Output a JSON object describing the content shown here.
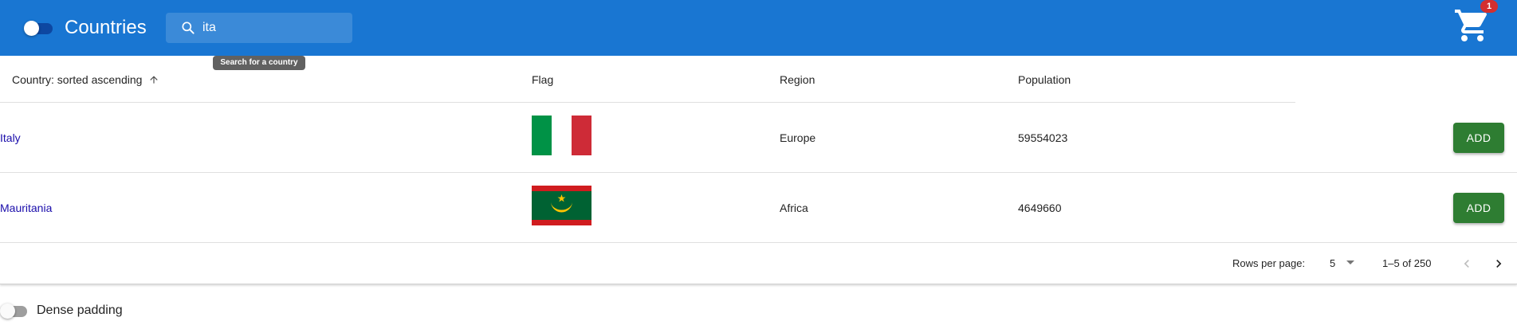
{
  "appbar": {
    "title": "Countries",
    "search_value": "ita",
    "search_tooltip": "Search for a country",
    "cart_badge": "1",
    "color": "#1976d2"
  },
  "table": {
    "columns": {
      "country": "Country: sorted ascending",
      "flag": "Flag",
      "region": "Region",
      "population": "Population"
    },
    "rows": [
      {
        "country": "Italy",
        "flag": "italy-flag",
        "region": "Europe",
        "population": "59554023",
        "action": "ADD"
      },
      {
        "country": "Mauritania",
        "flag": "mauritania-flag",
        "region": "Africa",
        "population": "4649660",
        "action": "ADD"
      }
    ]
  },
  "pagination": {
    "rows_per_page_label": "Rows per page:",
    "rows_per_page_value": "5",
    "range": "1–5 of 250"
  },
  "dense": {
    "label": "Dense padding"
  },
  "colors": {
    "add_button": "#2e7d32",
    "link": "#1a0dab",
    "badge": "#d32f2f"
  }
}
